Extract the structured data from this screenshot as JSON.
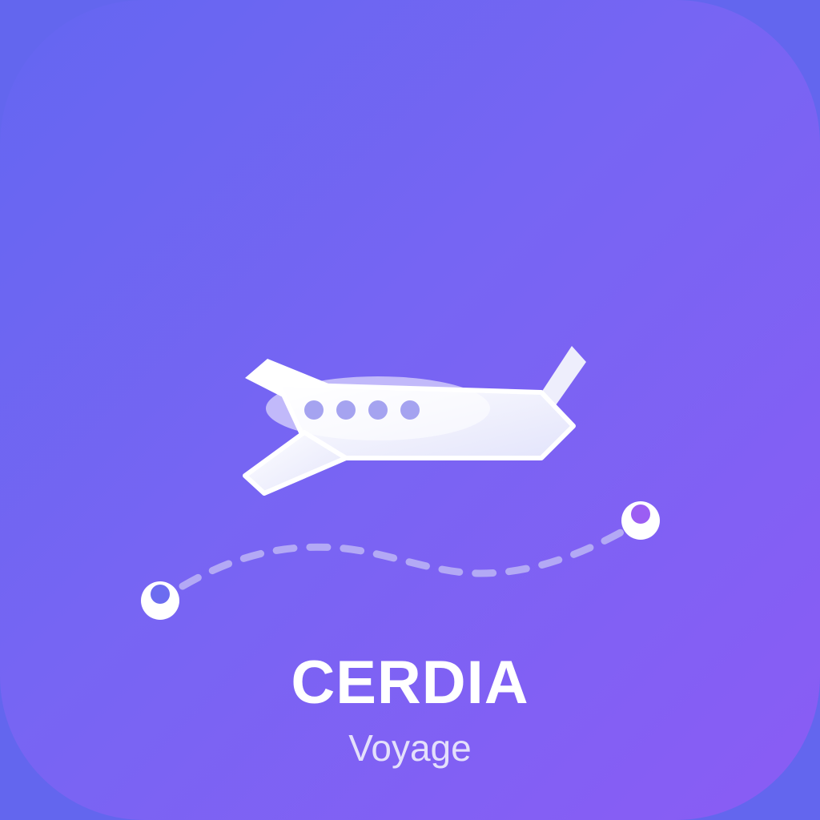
{
  "brand": {
    "name": "CERDIA",
    "tagline": "Voyage"
  },
  "icons": {
    "main": "airplane-icon",
    "route": "flight-route-path",
    "origin": "origin-marker-icon",
    "destination": "destination-marker-icon"
  },
  "colors": {
    "gradient_start": "#6466f1",
    "gradient_end": "#8a5cf4",
    "plane_body": "#ffffff",
    "plane_window": "#a5a3f0",
    "route_dash": "#b3a9f5",
    "origin_dot": "#6c6cf0",
    "destination_dot": "#9b5ef3"
  }
}
